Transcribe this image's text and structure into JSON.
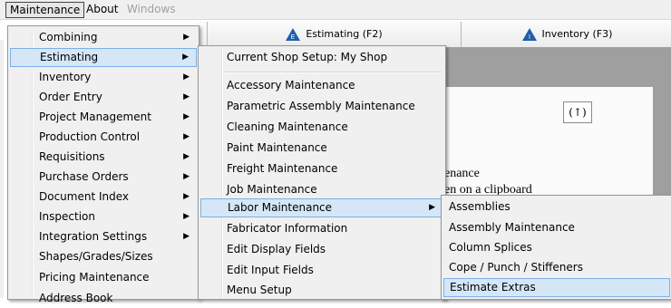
{
  "menubar": {
    "items": [
      "Maintenance",
      "About",
      "Windows"
    ]
  },
  "tabs": {
    "estimating": "Estimating (F2)",
    "inventory": "Inventory (F3)"
  },
  "background": {
    "up_button": "(↑)",
    "text_line1": "enance",
    "text_line2": "en on a clipboard"
  },
  "main_menu": {
    "items": [
      {
        "label": "Combining",
        "submenu": true
      },
      {
        "label": "Estimating",
        "submenu": true,
        "highlighted": true
      },
      {
        "label": "Inventory",
        "submenu": true
      },
      {
        "label": "Order Entry",
        "submenu": true
      },
      {
        "label": "Project Management",
        "submenu": true
      },
      {
        "label": "Production Control",
        "submenu": true
      },
      {
        "label": "Requisitions",
        "submenu": true
      },
      {
        "label": "Purchase Orders",
        "submenu": true
      },
      {
        "label": "Document Index",
        "submenu": true
      },
      {
        "label": "Inspection",
        "submenu": true
      },
      {
        "label": "Integration Settings",
        "submenu": true
      },
      {
        "label": "Shapes/Grades/Sizes",
        "submenu": false
      },
      {
        "label": "Pricing Maintenance",
        "submenu": false
      },
      {
        "label": "Address Book",
        "submenu": false
      }
    ]
  },
  "estimating_menu": {
    "items": [
      {
        "label": "Current Shop Setup: My Shop"
      },
      {
        "label": "Accessory Maintenance"
      },
      {
        "label": "Parametric Assembly Maintenance"
      },
      {
        "label": "Cleaning Maintenance"
      },
      {
        "label": "Paint Maintenance"
      },
      {
        "label": "Freight Maintenance"
      },
      {
        "label": "Job Maintenance"
      },
      {
        "label": "Labor Maintenance",
        "submenu": true,
        "highlighted": true
      },
      {
        "label": "Fabricator Information"
      },
      {
        "label": "Edit Display Fields"
      },
      {
        "label": "Edit Input Fields"
      },
      {
        "label": "Menu Setup"
      }
    ]
  },
  "labor_menu": {
    "items": [
      {
        "label": "Assemblies"
      },
      {
        "label": "Assembly Maintenance"
      },
      {
        "label": "Column Splices"
      },
      {
        "label": "Cope / Punch / Stiffeners"
      },
      {
        "label": "Estimate Extras",
        "highlighted": true
      }
    ]
  },
  "colors": {
    "highlight": "#d5e6f7",
    "highlight_border": "#7ab0e3",
    "menu_bg": "#f0f0f0",
    "panel_gray": "#9f9f9f",
    "tab_icon": "#1f5fa8"
  },
  "icons": {
    "submenu_arrow": "▶",
    "estimating_tab": "estimating-tab-icon",
    "inventory_tab": "inventory-tab-icon"
  }
}
